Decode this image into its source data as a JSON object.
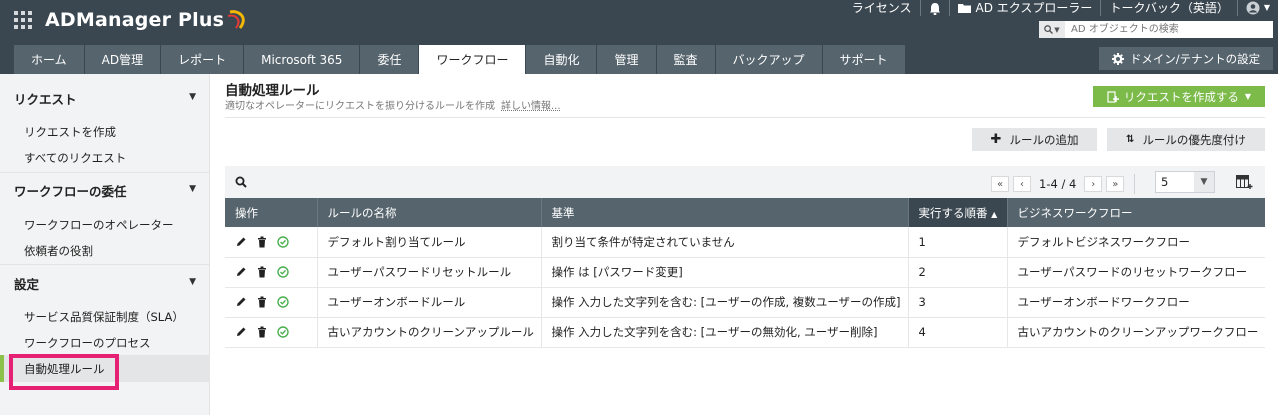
{
  "header": {
    "app_name": "ADManager Plus",
    "top_links": [
      "ライセンス",
      "AD エクスプローラー",
      "トークバック（英語）"
    ],
    "search_placeholder": "AD オブジェクトの検索",
    "domain_button": "ドメイン/テナントの設定"
  },
  "tabs": [
    {
      "label": "ホーム",
      "active": false
    },
    {
      "label": "AD管理",
      "active": false
    },
    {
      "label": "レポート",
      "active": false
    },
    {
      "label": "Microsoft 365",
      "active": false
    },
    {
      "label": "委任",
      "active": false
    },
    {
      "label": "ワークフロー",
      "active": true
    },
    {
      "label": "自動化",
      "active": false
    },
    {
      "label": "管理",
      "active": false
    },
    {
      "label": "監査",
      "active": false
    },
    {
      "label": "バックアップ",
      "active": false
    },
    {
      "label": "サポート",
      "active": false
    }
  ],
  "sidebar": {
    "sections": [
      {
        "title": "リクエスト",
        "items": [
          "リクエストを作成",
          "すべてのリクエスト"
        ]
      },
      {
        "title": "ワークフローの委任",
        "items": [
          "ワークフローのオペレーター",
          "依頼者の役割"
        ]
      },
      {
        "title": "設定",
        "items": [
          "サービス品質保証制度（SLA）",
          "ワークフローのプロセス",
          "自動処理ルール"
        ]
      }
    ],
    "active_item": "自動処理ルール"
  },
  "main": {
    "title": "自動処理ルール",
    "subtitle": "適切なオペレーターにリクエストを振り分けるルールを作成",
    "more_link": "詳しい情報...",
    "create_request_button": "リクエストを作成する",
    "add_rule_button": "ルールの追加",
    "prioritize_button": "ルールの優先度付け",
    "pager_text": "1-4 / 4",
    "per_page": "5"
  },
  "table": {
    "columns": [
      "操作",
      "ルールの名称",
      "基準",
      "実行する順番",
      "ビジネスワークフロー"
    ],
    "sorted_column": "実行する順番",
    "rows": [
      {
        "name": "デフォルト割り当てルール",
        "criteria": "割り当て条件が特定されていません",
        "order": "1",
        "workflow": "デフォルトビジネスワークフロー"
      },
      {
        "name": "ユーザーパスワードリセットルール",
        "criteria": "操作 は [パスワード変更]",
        "order": "2",
        "workflow": "ユーザーパスワードのリセットワークフロー"
      },
      {
        "name": "ユーザーオンボードルール",
        "criteria": "操作 入力した文字列を含む: [ユーザーの作成, 複数ユーザーの作成]",
        "order": "3",
        "workflow": "ユーザーオンボードワークフロー"
      },
      {
        "name": "古いアカウントのクリーンアップルール",
        "criteria": "操作 入力した文字列を含む: [ユーザーの無効化, ユーザー削除]",
        "order": "4",
        "workflow": "古いアカウントのクリーンアップワークフロー"
      }
    ]
  },
  "colors": {
    "header_bg": "#3a4750",
    "tab_bg": "#56646d",
    "accent_green": "#7cba4a",
    "highlight_pink": "#e62072"
  }
}
